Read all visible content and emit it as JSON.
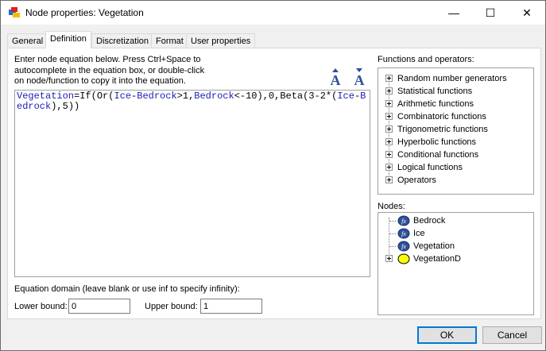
{
  "window": {
    "title": "Node properties: Vegetation",
    "minimize_glyph": "—",
    "maximize_glyph": "☐",
    "close_glyph": "✕"
  },
  "tabs": [
    {
      "label": "General",
      "active": false
    },
    {
      "label": "Definition",
      "active": true
    },
    {
      "label": "Discretization",
      "active": false
    },
    {
      "label": "Format",
      "active": false
    },
    {
      "label": "User properties",
      "active": false
    }
  ],
  "definition": {
    "instructions_line1": "Enter node equation below. Press Ctrl+Space to",
    "instructions_line2": "autocomplete in the equation box, or double-click",
    "instructions_line3": "on node/function to copy it into the equation.",
    "font_increase_icon": "font-increase-icon",
    "font_decrease_icon": "font-decrease-icon",
    "equation_tokens": [
      {
        "t": "Vegetation",
        "kw": true
      },
      {
        "t": "=If(Or(",
        "kw": false
      },
      {
        "t": "Ice",
        "kw": true
      },
      {
        "t": "-",
        "kw": false
      },
      {
        "t": "Bedrock",
        "kw": true
      },
      {
        "t": ">1,",
        "kw": false
      },
      {
        "t": "Bedrock",
        "kw": true
      },
      {
        "t": "<-10),0,Beta(3-2*(",
        "kw": false
      },
      {
        "t": "Ice",
        "kw": true
      },
      {
        "t": "-",
        "kw": false
      },
      {
        "t": "Bedrock",
        "kw": true
      },
      {
        "t": "),5))",
        "kw": false
      }
    ],
    "functions_label": "Functions and operators:",
    "functions": [
      "Random number generators",
      "Statistical functions",
      "Arithmetic functions",
      "Combinatoric functions",
      "Trigonometric functions",
      "Hyperbolic functions",
      "Conditional functions",
      "Logical functions",
      "Operators"
    ],
    "nodes_label": "Nodes:",
    "nodes": [
      {
        "label": "Bedrock",
        "icon": "fx-node-icon",
        "expandable": false
      },
      {
        "label": "Ice",
        "icon": "fx-node-icon",
        "expandable": false
      },
      {
        "label": "Vegetation",
        "icon": "fx-node-icon",
        "expandable": false
      },
      {
        "label": "VegetationD",
        "icon": "yellow-ellipse-node-icon",
        "expandable": true
      }
    ],
    "domain_label": "Equation domain (leave blank or use inf to specify infinity):",
    "lower_bound_label": "Lower bound:",
    "lower_bound_value": "0",
    "upper_bound_label": "Upper bound:",
    "upper_bound_value": "1"
  },
  "buttons": {
    "ok": "OK",
    "cancel": "Cancel"
  },
  "colors": {
    "keyword": "#1a1ab8",
    "fx_icon": "#2e4f9c",
    "node_yellow": "#ffff00",
    "default_button_border": "#0078d7"
  }
}
